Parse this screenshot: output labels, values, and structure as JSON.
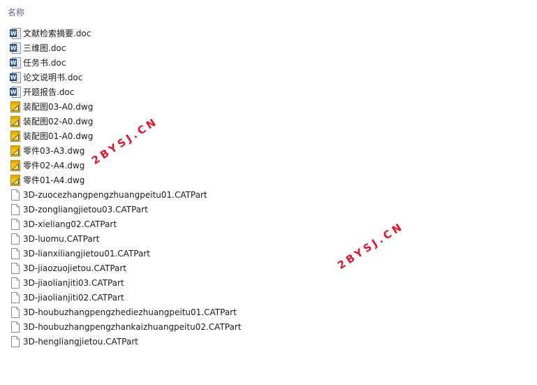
{
  "header": {
    "name_label": "名称"
  },
  "files": [
    {
      "name": "文献检索摘要.doc",
      "type": "doc",
      "icon": "word-doc-icon"
    },
    {
      "name": "三维图.doc",
      "type": "doc",
      "icon": "word-doc-icon"
    },
    {
      "name": "任务书.doc",
      "type": "doc",
      "icon": "word-doc-icon"
    },
    {
      "name": "论文说明书.doc",
      "type": "doc",
      "icon": "word-doc-icon"
    },
    {
      "name": "开题报告.doc",
      "type": "doc",
      "icon": "word-doc-icon"
    },
    {
      "name": "装配图03-A0.dwg",
      "type": "dwg",
      "icon": "autocad-dwg-icon"
    },
    {
      "name": "装配图02-A0.dwg",
      "type": "dwg",
      "icon": "autocad-dwg-icon"
    },
    {
      "name": "装配图01-A0.dwg",
      "type": "dwg",
      "icon": "autocad-dwg-icon"
    },
    {
      "name": "零件03-A3.dwg",
      "type": "dwg",
      "icon": "autocad-dwg-icon"
    },
    {
      "name": "零件02-A4.dwg",
      "type": "dwg",
      "icon": "autocad-dwg-icon"
    },
    {
      "name": "零件01-A4.dwg",
      "type": "dwg",
      "icon": "autocad-dwg-icon"
    },
    {
      "name": "3D-zuocezhangpengzhuangpeitu01.CATPart",
      "type": "catpart",
      "icon": "blank-file-icon"
    },
    {
      "name": "3D-zongliangjietou03.CATPart",
      "type": "catpart",
      "icon": "blank-file-icon"
    },
    {
      "name": "3D-xieliang02.CATPart",
      "type": "catpart",
      "icon": "blank-file-icon"
    },
    {
      "name": "3D-luomu.CATPart",
      "type": "catpart",
      "icon": "blank-file-icon"
    },
    {
      "name": "3D-lianxiliangjietou01.CATPart",
      "type": "catpart",
      "icon": "blank-file-icon"
    },
    {
      "name": "3D-jiaozuojietou.CATPart",
      "type": "catpart",
      "icon": "blank-file-icon"
    },
    {
      "name": "3D-jiaolianjiti03.CATPart",
      "type": "catpart",
      "icon": "blank-file-icon"
    },
    {
      "name": "3D-jiaolianjiti02.CATPart",
      "type": "catpart",
      "icon": "blank-file-icon"
    },
    {
      "name": "3D-houbuzhangpengzhediezhuangpeitu01.CATPart",
      "type": "catpart",
      "icon": "blank-file-icon"
    },
    {
      "name": "3D-houbuzhangpengzhankaizhuangpeitu02.CATPart",
      "type": "catpart",
      "icon": "blank-file-icon"
    },
    {
      "name": "3D-hengliangjietou.CATPart",
      "type": "catpart",
      "icon": "blank-file-icon"
    }
  ],
  "watermarks": [
    {
      "text": "2BYSJ.CN"
    },
    {
      "text": "2BYSJ.CN"
    }
  ],
  "colors": {
    "watermark": "#e8142c",
    "header": "#5a6a85",
    "word_blue": "#2b5797",
    "dwg_yellow": "#f2c417"
  }
}
